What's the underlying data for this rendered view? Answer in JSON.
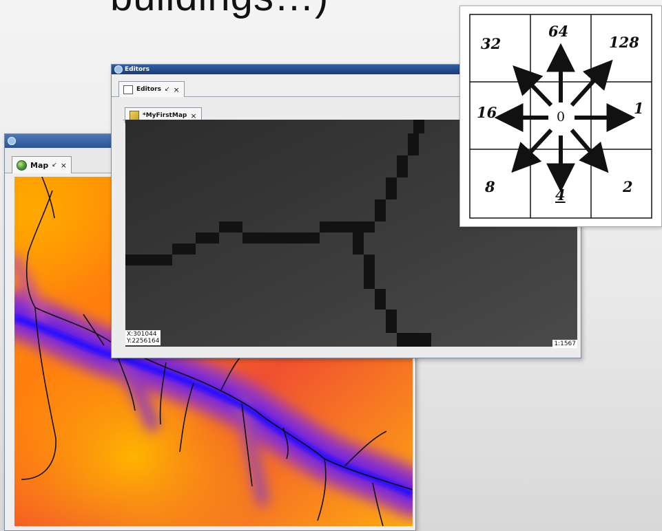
{
  "slide": {
    "title_fragment": "buildings…)"
  },
  "editors_window": {
    "title": "Editors",
    "tab_label": "Editors",
    "inner_tab_label": "*MyFirstMap",
    "coord_x": "X:301044",
    "coord_y": "Y:2256164",
    "scale": "1:1567"
  },
  "map_window": {
    "tab_label": "Map"
  },
  "d8_diagram": {
    "center": "0",
    "cells": {
      "nw": "32",
      "n": "64",
      "ne": "128",
      "w": "16",
      "e": "1",
      "sw": "8",
      "s": "4",
      "se": "2"
    }
  },
  "icons": {
    "pin": "↙",
    "close": "×"
  }
}
